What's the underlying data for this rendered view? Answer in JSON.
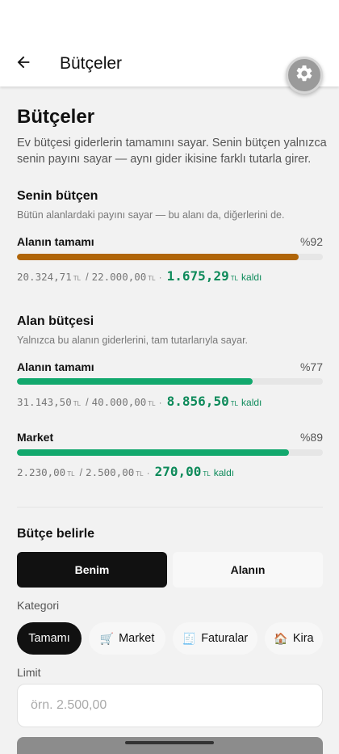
{
  "appbar": {
    "title": "Bütçeler"
  },
  "page": {
    "title": "Bütçeler",
    "intro": "Ev bütçesi giderlerin tamamını sayar. Senin bütçen yalnızca senin payını sayar — aynı gider ikisine farklı tutarla girer."
  },
  "currency": "TL",
  "remaining_word": "kaldı",
  "personal_budget": {
    "title": "Senin bütçen",
    "subtitle": "Bütün alanlardaki payını sayar — bu alanı da, diğerlerini de.",
    "rows": [
      {
        "label": "Alanın tamamı",
        "percent_text": "%92",
        "progress": 0.92,
        "color": "#b06508",
        "spent": "20.324,71",
        "limit": "22.000,00",
        "remaining": "1.675,29"
      }
    ]
  },
  "space_budget": {
    "title": "Alan bütçesi",
    "subtitle": "Yalnızca bu alanın giderlerini, tam tutarlarıyla sayar.",
    "rows": [
      {
        "label": "Alanın tamamı",
        "percent_text": "%77",
        "progress": 0.77,
        "color": "#12a86d",
        "spent": "31.143,50",
        "limit": "40.000,00",
        "remaining": "8.856,50"
      },
      {
        "label": "Market",
        "percent_text": "%89",
        "progress": 0.89,
        "color": "#12a86d",
        "spent": "2.230,00",
        "limit": "2.500,00",
        "remaining": "270,00"
      }
    ]
  },
  "set_budget": {
    "title": "Bütçe belirle",
    "segments": [
      {
        "label": "Benim",
        "selected": true
      },
      {
        "label": "Alanın",
        "selected": false
      }
    ],
    "category_label": "Kategori",
    "categories": [
      {
        "label": "Tamamı",
        "emoji": "",
        "selected": true
      },
      {
        "label": "Market",
        "emoji": "🛒",
        "selected": false
      },
      {
        "label": "Faturalar",
        "emoji": "🧾",
        "selected": false
      },
      {
        "label": "Kira",
        "emoji": "🏠",
        "selected": false
      }
    ],
    "limit_label": "Limit",
    "limit_placeholder": "örn. 2.500,00",
    "limit_value": ""
  },
  "icons": {
    "back": "arrow-left-icon",
    "settings": "gear-icon"
  }
}
